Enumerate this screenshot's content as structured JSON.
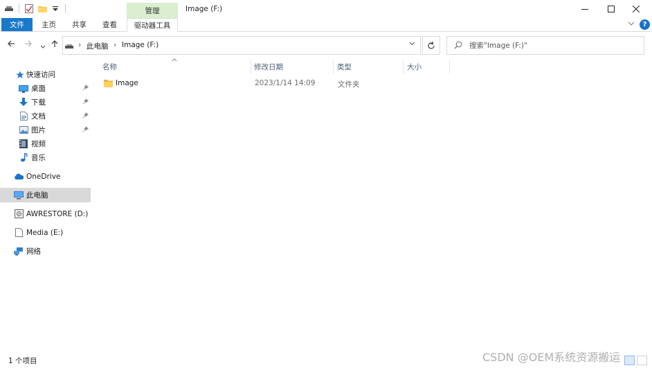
{
  "window": {
    "title": "Image (F:)",
    "minimize": "—",
    "maximize": "☐",
    "close": "✕"
  },
  "ribbon": {
    "context_group_label": "管理",
    "tabs": [
      "文件",
      "主页",
      "共享",
      "查看"
    ],
    "context_tab": "驱动器工具",
    "accent_color": "#1979ca",
    "context_color": "#d9efce"
  },
  "address": {
    "crumbs": [
      "此电脑",
      "Image (F:)"
    ],
    "search_placeholder": "搜索\"Image (F:)\""
  },
  "nav": {
    "quick_access": "快速访问",
    "pinned": [
      {
        "label": "桌面",
        "icon": "desktop-icon"
      },
      {
        "label": "下载",
        "icon": "download-icon"
      },
      {
        "label": "文档",
        "icon": "document-icon"
      },
      {
        "label": "图片",
        "icon": "picture-icon"
      }
    ],
    "unpinned": [
      {
        "label": "视频",
        "icon": "video-icon"
      },
      {
        "label": "音乐",
        "icon": "music-icon"
      }
    ],
    "onedrive": "OneDrive",
    "this_pc": "此电脑",
    "drive_d": "AWRESTORE (D:)",
    "drive_e": "Media (E:)",
    "network": "网络"
  },
  "columns": [
    "名称",
    "修改日期",
    "类型",
    "大小"
  ],
  "files": [
    {
      "name": "Image",
      "modified": "2023/1/14 14:09",
      "type": "文件夹",
      "size": ""
    }
  ],
  "status": {
    "count": "1 个项目"
  },
  "watermark": "CSDN @OEM系统资源搬运"
}
